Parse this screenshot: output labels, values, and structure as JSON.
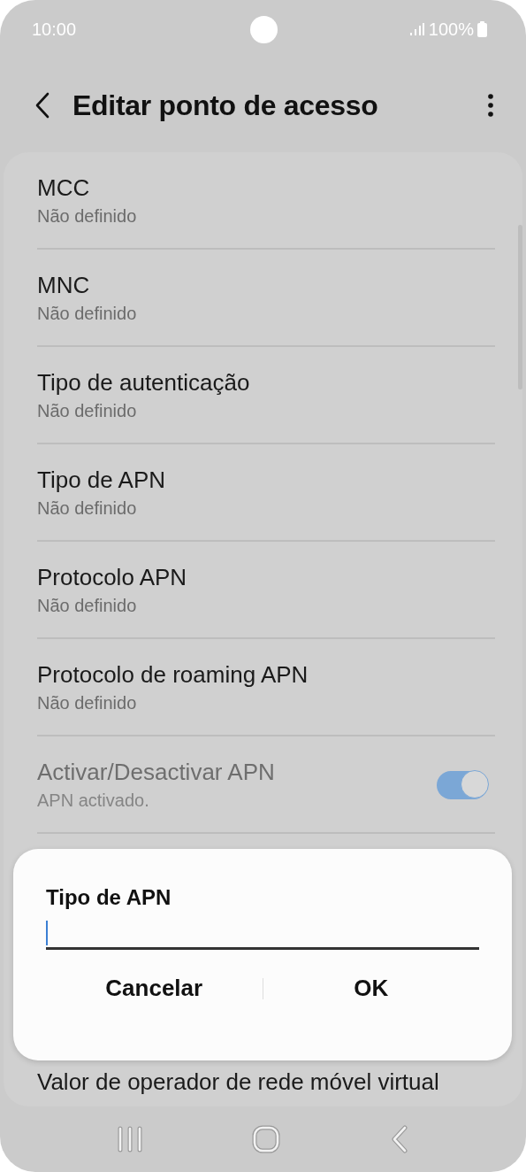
{
  "status_bar": {
    "time": "10:00",
    "battery": "100%"
  },
  "header": {
    "title": "Editar ponto de acesso"
  },
  "settings": [
    {
      "kind": "value",
      "title": "MCC",
      "value": "Não definido",
      "disabled": false
    },
    {
      "kind": "value",
      "title": "MNC",
      "value": "Não definido",
      "disabled": false
    },
    {
      "kind": "value",
      "title": "Tipo de autenticação",
      "value": "Não definido",
      "disabled": false
    },
    {
      "kind": "value",
      "title": "Tipo de APN",
      "value": "Não definido",
      "disabled": false
    },
    {
      "kind": "value",
      "title": "Protocolo APN",
      "value": "Não definido",
      "disabled": false
    },
    {
      "kind": "value",
      "title": "Protocolo de roaming APN",
      "value": "Não definido",
      "disabled": false
    },
    {
      "kind": "toggle",
      "title": "Activar/Desactivar APN",
      "value": "APN activado.",
      "on": true,
      "disabled": true
    },
    {
      "kind": "value",
      "title": "Valor de operador de rede móvel virtual",
      "disabled": false
    }
  ],
  "dialog": {
    "title": "Tipo de APN",
    "buttons": [
      "Cancelar",
      "OK"
    ]
  }
}
